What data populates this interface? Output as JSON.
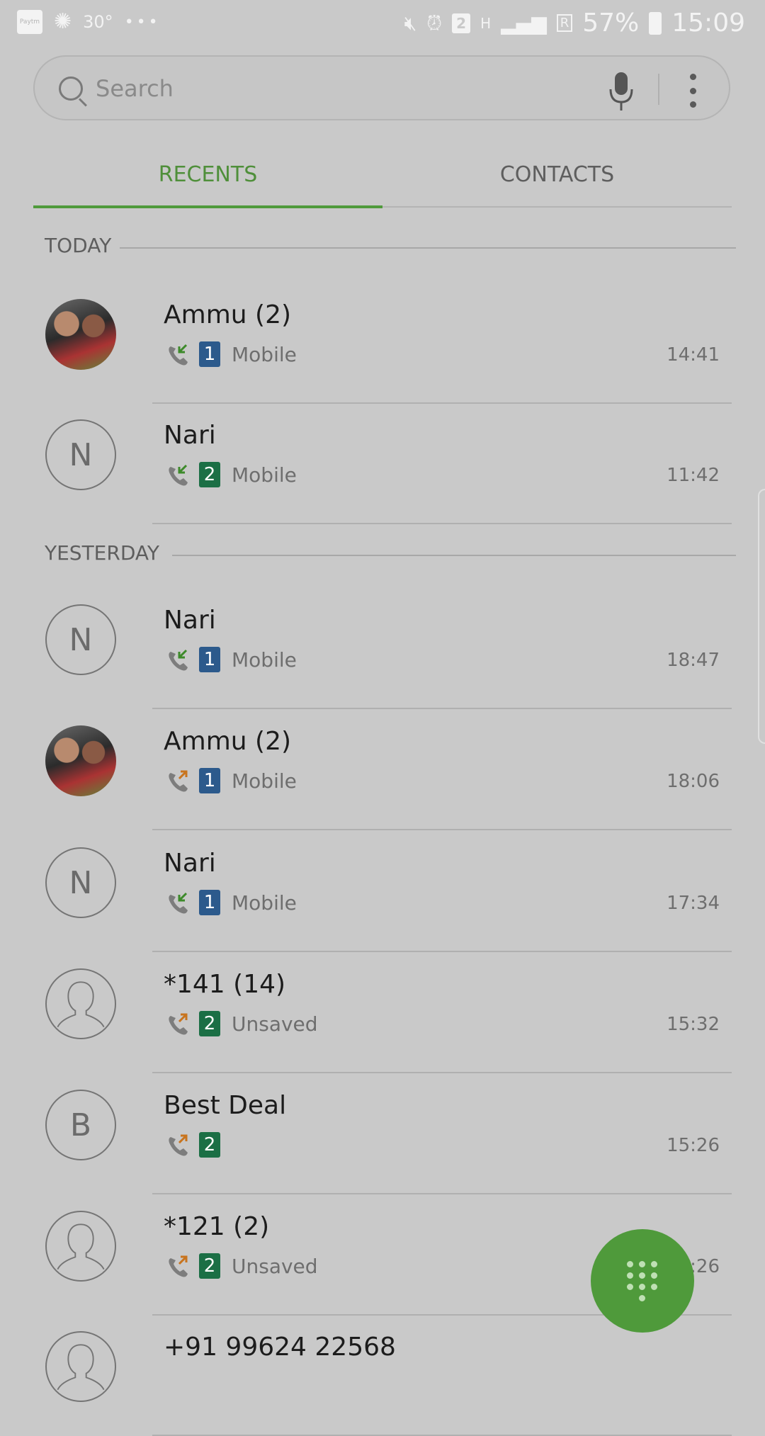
{
  "status_bar": {
    "paytm": "Paytm",
    "temperature": "30°",
    "notification_more": "•••",
    "sim_badge": "2",
    "network": "H",
    "roaming": "R",
    "battery": "57%",
    "time": "15:09"
  },
  "search": {
    "placeholder": "Search"
  },
  "tabs": [
    {
      "label": "RECENTS",
      "selected": true
    },
    {
      "label": "CONTACTS",
      "selected": false
    }
  ],
  "sections": [
    {
      "label": "TODAY",
      "calls": [
        {
          "name": "Ammu (2)",
          "avatar": "photo",
          "initial": "",
          "direction": "incoming",
          "sim": "1",
          "label": "Mobile",
          "time": "14:41"
        },
        {
          "name": "Nari",
          "avatar": "letter",
          "initial": "N",
          "direction": "incoming",
          "sim": "2",
          "label": "Mobile",
          "time": "11:42"
        }
      ]
    },
    {
      "label": "YESTERDAY",
      "calls": [
        {
          "name": "Nari",
          "avatar": "letter",
          "initial": "N",
          "direction": "incoming",
          "sim": "1",
          "label": "Mobile",
          "time": "18:47"
        },
        {
          "name": "Ammu (2)",
          "avatar": "photo",
          "initial": "",
          "direction": "outgoing",
          "sim": "1",
          "label": "Mobile",
          "time": "18:06"
        },
        {
          "name": "Nari",
          "avatar": "letter",
          "initial": "N",
          "direction": "incoming",
          "sim": "1",
          "label": "Mobile",
          "time": "17:34"
        },
        {
          "name": "*141 (14)",
          "avatar": "person",
          "initial": "",
          "direction": "outgoing",
          "sim": "2",
          "label": "Unsaved",
          "time": "15:32"
        },
        {
          "name": "Best Deal",
          "avatar": "letter",
          "initial": "B",
          "direction": "outgoing",
          "sim": "2",
          "label": "",
          "time": "15:26"
        },
        {
          "name": "*121 (2)",
          "avatar": "person",
          "initial": "",
          "direction": "outgoing",
          "sim": "2",
          "label": "Unsaved",
          "time": "15:26"
        },
        {
          "name": "+91 99624 22568",
          "avatar": "person",
          "initial": "",
          "direction": "",
          "sim": "",
          "label": "",
          "time": ""
        }
      ]
    }
  ],
  "colors": {
    "accent": "#4f9a3b",
    "incoming_arrow": "#3d8a2a",
    "outgoing_arrow": "#c8741e",
    "sim1": "#2c5a8c",
    "sim2": "#1b6f45"
  },
  "icons": {
    "search": "search-icon",
    "mic": "mic-icon",
    "more": "more-options-icon",
    "dialpad": "dialpad-icon"
  }
}
